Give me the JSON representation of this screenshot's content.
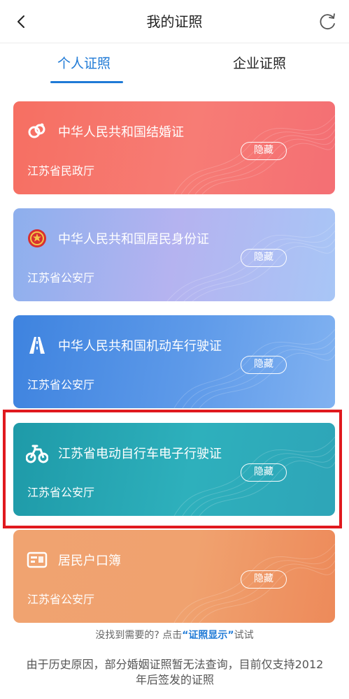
{
  "nav": {
    "title": "我的证照",
    "back_icon": "chevron-left-icon",
    "refresh_icon": "refresh-icon"
  },
  "tabs": [
    {
      "label": "个人证照",
      "active": true
    },
    {
      "label": "企业证照",
      "active": false
    }
  ],
  "colors": {
    "accent": "#1f7ad6",
    "highlight": "#e0191e"
  },
  "cards": [
    {
      "title": "中华人民共和国结婚证",
      "issuer": "江苏省民政厅",
      "action": "隐藏",
      "icon": "marriage-emblem-icon",
      "color": "#f66f62"
    },
    {
      "title": "中华人民共和国居民身份证",
      "issuer": "江苏省公安厅",
      "action": "隐藏",
      "icon": "national-emblem-icon",
      "color": "#9fb4ef"
    },
    {
      "title": "中华人民共和国机动车行驶证",
      "issuer": "江苏省公安厅",
      "action": "隐藏",
      "icon": "road-icon",
      "color": "#4a8ae3"
    },
    {
      "title": "江苏省电动自行车电子行驶证",
      "issuer": "江苏省公安厅",
      "action": "隐藏",
      "icon": "ebike-icon",
      "color": "#25a4b1",
      "highlighted": true
    },
    {
      "title": "居民户口簿",
      "issuer": "江苏省公安厅",
      "action": "隐藏",
      "icon": "household-book-icon",
      "color": "#f0a06d"
    }
  ],
  "hint": {
    "prefix": "没找到需要的? 点击",
    "link": "“证照显示”",
    "suffix": "试试"
  },
  "notice": "由于历史原因，部分婚姻证照暂无法查询，目前仅支持2012年后签发的证照"
}
